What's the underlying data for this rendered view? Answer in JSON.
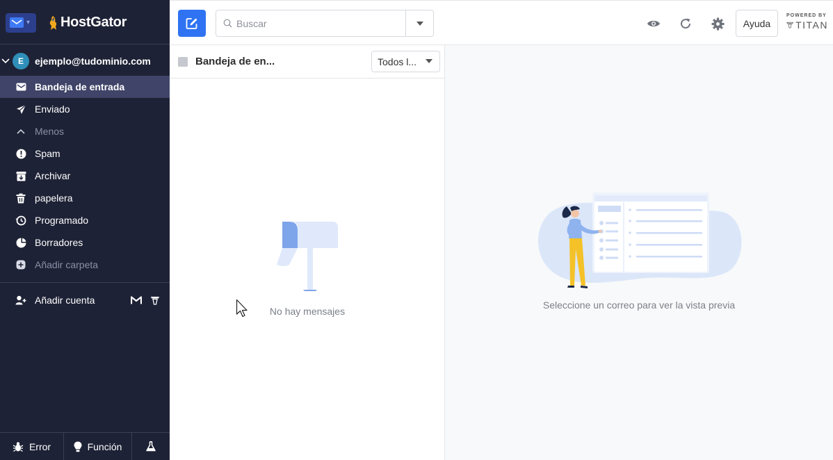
{
  "brand": {
    "name": "HostGator"
  },
  "account": {
    "initial": "E",
    "email": "ejemplo@tudominio.com"
  },
  "folders": [
    {
      "label": "Bandeja de entrada",
      "icon": "envelope-icon"
    },
    {
      "label": "Enviado",
      "icon": "send-icon"
    },
    {
      "label": "Menos",
      "icon": "chevron-up-icon"
    },
    {
      "label": "Spam",
      "icon": "spam-icon"
    },
    {
      "label": "Archivar",
      "icon": "archive-icon"
    },
    {
      "label": "papelera",
      "icon": "trash-icon"
    },
    {
      "label": "Programado",
      "icon": "schedule-icon"
    },
    {
      "label": "Borradores",
      "icon": "drafts-icon"
    },
    {
      "label": "Añadir carpeta",
      "icon": "plus-icon"
    }
  ],
  "add_account": {
    "label": "Añadir cuenta"
  },
  "footer": {
    "error_label": "Error",
    "feature_label": "Función"
  },
  "search": {
    "placeholder": "Buscar"
  },
  "toolbar": {
    "help_label": "Ayuda",
    "powered_by": "POWERED BY",
    "powered_brand": "TITAN"
  },
  "list": {
    "title": "Bandeja de en...",
    "filter": "Todos l...",
    "empty_message": "No hay mensajes"
  },
  "preview": {
    "empty_message": "Seleccione un correo para ver la vista previa"
  },
  "colors": {
    "sidebar_bg": "#1e2236",
    "accent": "#2f73f3",
    "active_item": "#3f4468"
  }
}
